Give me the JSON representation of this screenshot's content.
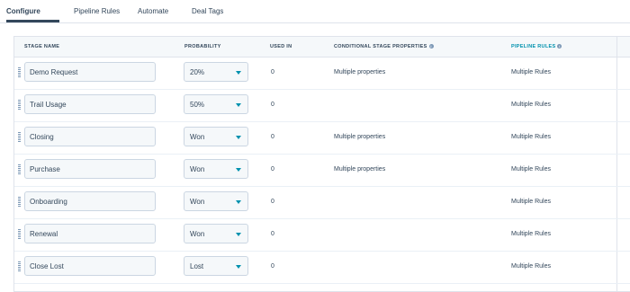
{
  "tabs": [
    {
      "label": "Configure",
      "active": true
    },
    {
      "label": "Pipeline Rules",
      "active": false
    },
    {
      "label": "Automate",
      "active": false
    },
    {
      "label": "Deal Tags",
      "active": false
    }
  ],
  "columns": {
    "stage_name": "STAGE NAME",
    "probability": "PROBABILITY",
    "used_in": "USED IN",
    "conditional": "CONDITIONAL STAGE PROPERTIES",
    "pipeline_rules": "PIPELINE RULES"
  },
  "rows": [
    {
      "stage": "Demo Request",
      "probability": "20%",
      "used_in": "0",
      "conditional": "Multiple properties",
      "rules": "Multiple Rules"
    },
    {
      "stage": "Trail Usage",
      "probability": "50%",
      "used_in": "0",
      "conditional": "",
      "rules": "Multiple Rules"
    },
    {
      "stage": "Closing",
      "probability": "Won",
      "used_in": "0",
      "conditional": "Multiple properties",
      "rules": "Multiple Rules"
    },
    {
      "stage": "Purchase",
      "probability": "Won",
      "used_in": "0",
      "conditional": "Multiple properties",
      "rules": "Multiple Rules"
    },
    {
      "stage": "Onboarding",
      "probability": "Won",
      "used_in": "0",
      "conditional": "",
      "rules": "Multiple Rules"
    },
    {
      "stage": "Renewal",
      "probability": "Won",
      "used_in": "0",
      "conditional": "",
      "rules": "Multiple Rules"
    },
    {
      "stage": "Close Lost",
      "probability": "Lost",
      "used_in": "0",
      "conditional": "",
      "rules": "Multiple Rules"
    }
  ],
  "colors": {
    "accent": "#0091ae",
    "text": "#33475b",
    "border": "#cbd6e2",
    "header_bg": "#f5f8fa"
  },
  "icons": {
    "info": "info-icon",
    "drag": "drag-handle-icon",
    "dropdown": "chevron-down-icon"
  }
}
